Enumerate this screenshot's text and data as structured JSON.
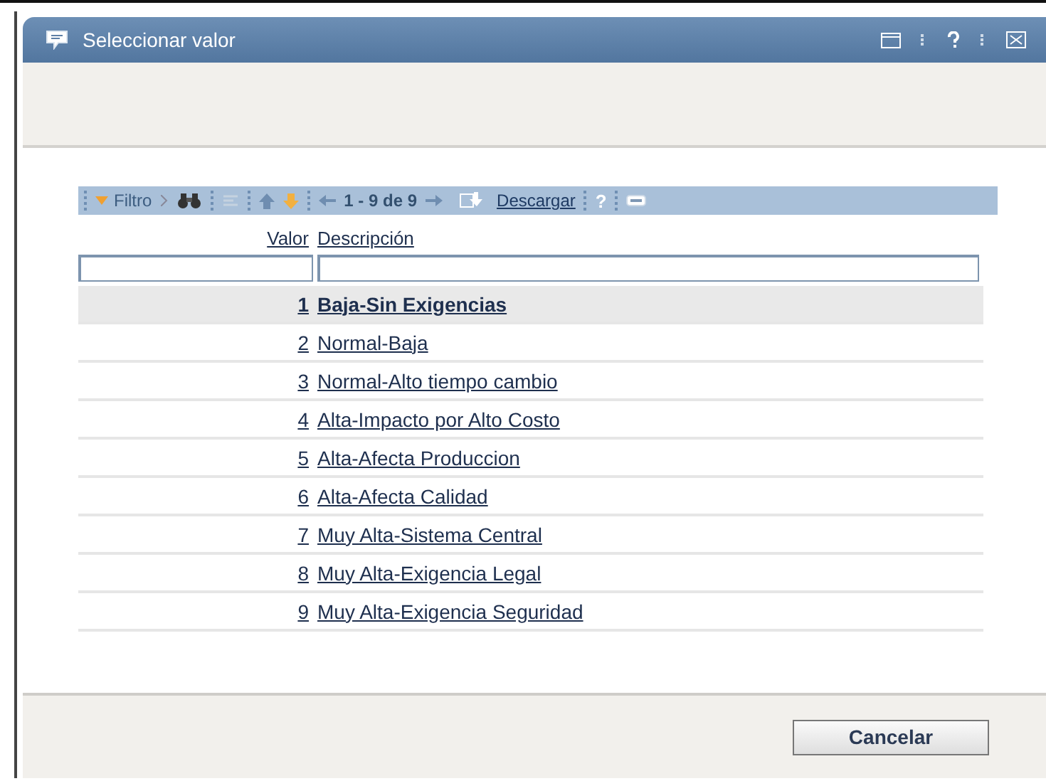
{
  "dialog": {
    "title": "Seleccionar valor"
  },
  "toolbar": {
    "filter": "Filtro",
    "pager": "1 - 9 de 9",
    "download": "Descargar",
    "help": "?"
  },
  "table": {
    "columns": [
      "Valor",
      "Descripción"
    ],
    "rows": [
      {
        "value": "1",
        "description": "Baja-Sin Exigencias",
        "selected": true
      },
      {
        "value": "2",
        "description": "Normal-Baja",
        "selected": false
      },
      {
        "value": "3",
        "description": "Normal-Alto tiempo cambio",
        "selected": false
      },
      {
        "value": "4",
        "description": "Alta-Impacto por Alto Costo",
        "selected": false
      },
      {
        "value": "5",
        "description": "Alta-Afecta Produccion",
        "selected": false
      },
      {
        "value": "6",
        "description": "Alta-Afecta Calidad",
        "selected": false
      },
      {
        "value": "7",
        "description": "Muy Alta-Sistema Central",
        "selected": false
      },
      {
        "value": "8",
        "description": "Muy Alta-Exigencia Legal",
        "selected": false
      },
      {
        "value": "9",
        "description": "Muy Alta-Exigencia Seguridad",
        "selected": false
      }
    ]
  },
  "buttons": [
    "Cancelar"
  ]
}
